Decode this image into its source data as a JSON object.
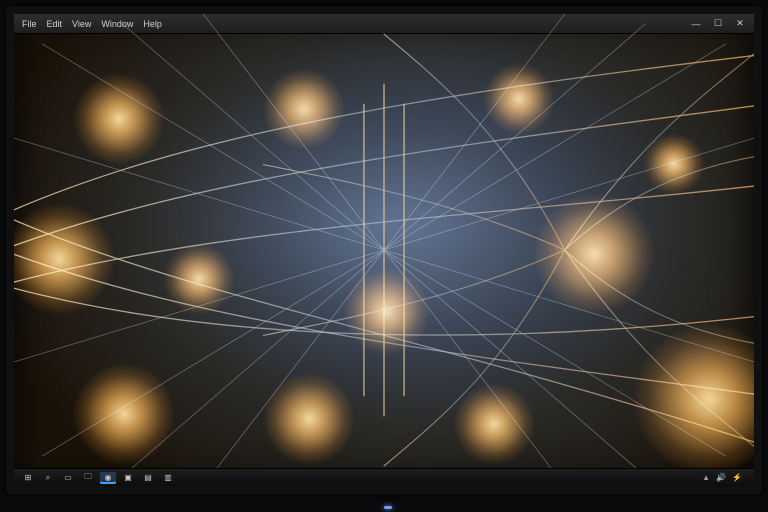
{
  "titlebar": {
    "menu": [
      "File",
      "Edit",
      "View",
      "Window",
      "Help"
    ],
    "title": "",
    "window_controls": [
      "min",
      "max",
      "close"
    ]
  },
  "artwork": {
    "description": "symmetrical-light-streaks",
    "accent_color": "#f5c46a",
    "background_tint": "#4a5a78"
  },
  "taskbar": {
    "icons": [
      {
        "name": "start-icon",
        "glyph": "⊞",
        "active": false
      },
      {
        "name": "search-icon",
        "glyph": "⌕",
        "active": false
      },
      {
        "name": "task-view-icon",
        "glyph": "▭",
        "active": false
      },
      {
        "name": "explorer-icon",
        "glyph": "🗀",
        "active": false
      },
      {
        "name": "browser-icon",
        "glyph": "◉",
        "active": true
      },
      {
        "name": "app-icon",
        "glyph": "▣",
        "active": false
      },
      {
        "name": "app2-icon",
        "glyph": "▤",
        "active": false
      },
      {
        "name": "app3-icon",
        "glyph": "▥",
        "active": false
      }
    ],
    "tray": {
      "items": [
        "▲",
        "🔊",
        "⚡"
      ],
      "clock": ""
    }
  }
}
